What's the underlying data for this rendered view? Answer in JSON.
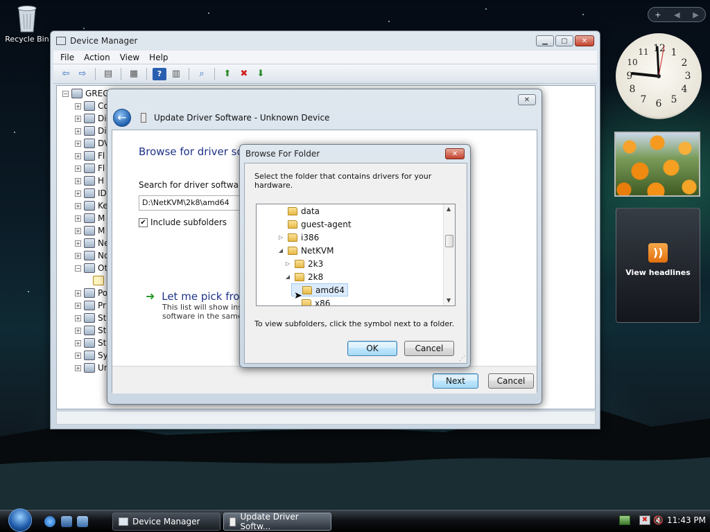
{
  "desktop": {
    "recycle_bin_label": "Recycle Bin",
    "gadgets": {
      "add_glyph": "+",
      "prev_glyph": "◀",
      "next_glyph": "▶",
      "clock_numbers": [
        "12",
        "1",
        "2",
        "3",
        "4",
        "5",
        "6",
        "7",
        "8",
        "9",
        "10",
        "11"
      ],
      "feed_label": "View headlines"
    }
  },
  "device_manager": {
    "title": "Device Manager",
    "menu": [
      "File",
      "Action",
      "View",
      "Help"
    ],
    "root_label": "GREG",
    "tree": [
      {
        "label": "Co"
      },
      {
        "label": "Di"
      },
      {
        "label": "Di"
      },
      {
        "label": "DV"
      },
      {
        "label": "Fl"
      },
      {
        "label": "Fl"
      },
      {
        "label": "H"
      },
      {
        "label": "ID"
      },
      {
        "label": "Ke"
      },
      {
        "label": "M"
      },
      {
        "label": "M"
      },
      {
        "label": "Ne"
      },
      {
        "label": "No"
      },
      {
        "label": "Ot"
      },
      {
        "label": ""
      },
      {
        "label": "Po"
      },
      {
        "label": "Pr"
      },
      {
        "label": "St"
      },
      {
        "label": "St"
      },
      {
        "label": "St"
      },
      {
        "label": "Sy"
      },
      {
        "label": "Ur"
      }
    ]
  },
  "wizard": {
    "title": "Update Driver Software - Unknown Device",
    "heading": "Browse for driver sof",
    "search_label": "Search for driver software in",
    "path_value": "D:\\NetKVM\\2k8\\amd64",
    "include_subfolders": "Include subfolders",
    "pick_title": "Let me pick from",
    "pick_desc_line1": "This list will show inst",
    "pick_desc_line2": "software in the same",
    "next_label": "Next",
    "cancel_label": "Cancel"
  },
  "browse": {
    "title": "Browse For Folder",
    "instruction": "Select the folder that contains drivers for your hardware.",
    "folders": [
      {
        "label": "data",
        "arrow": ""
      },
      {
        "label": "guest-agent",
        "arrow": ""
      },
      {
        "label": "i386",
        "arrow": "▷"
      },
      {
        "label": "NetKVM",
        "arrow": "◢"
      },
      {
        "label": "2k3",
        "arrow": "▷"
      },
      {
        "label": "2k8",
        "arrow": "◢"
      },
      {
        "label": "amd64",
        "arrow": ""
      },
      {
        "label": "x86",
        "arrow": ""
      }
    ],
    "hint": "To view subfolders, click the symbol next to a folder.",
    "ok_label": "OK",
    "cancel_label": "Cancel"
  },
  "taskbar": {
    "tasks": [
      "Device Manager",
      "Update Driver Softw..."
    ],
    "time": "11:43 PM"
  }
}
